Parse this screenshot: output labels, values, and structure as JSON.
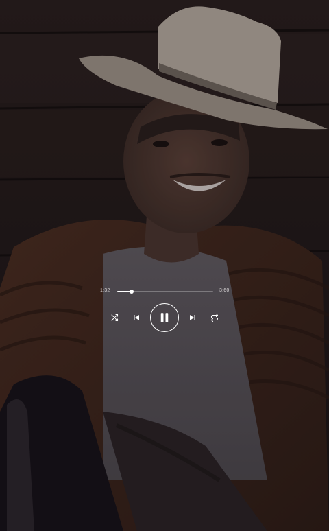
{
  "player": {
    "elapsed": "1:32",
    "total": "3:60",
    "progress": 0.15
  },
  "controls": {
    "shuffle_icon": "shuffle-icon",
    "prev_icon": "skip-previous-icon",
    "playpause_icon": "pause-icon",
    "next_icon": "skip-next-icon",
    "repeat_icon": "repeat-icon"
  },
  "colors": {
    "controls": "#ffffff",
    "track": "#ffffff"
  }
}
